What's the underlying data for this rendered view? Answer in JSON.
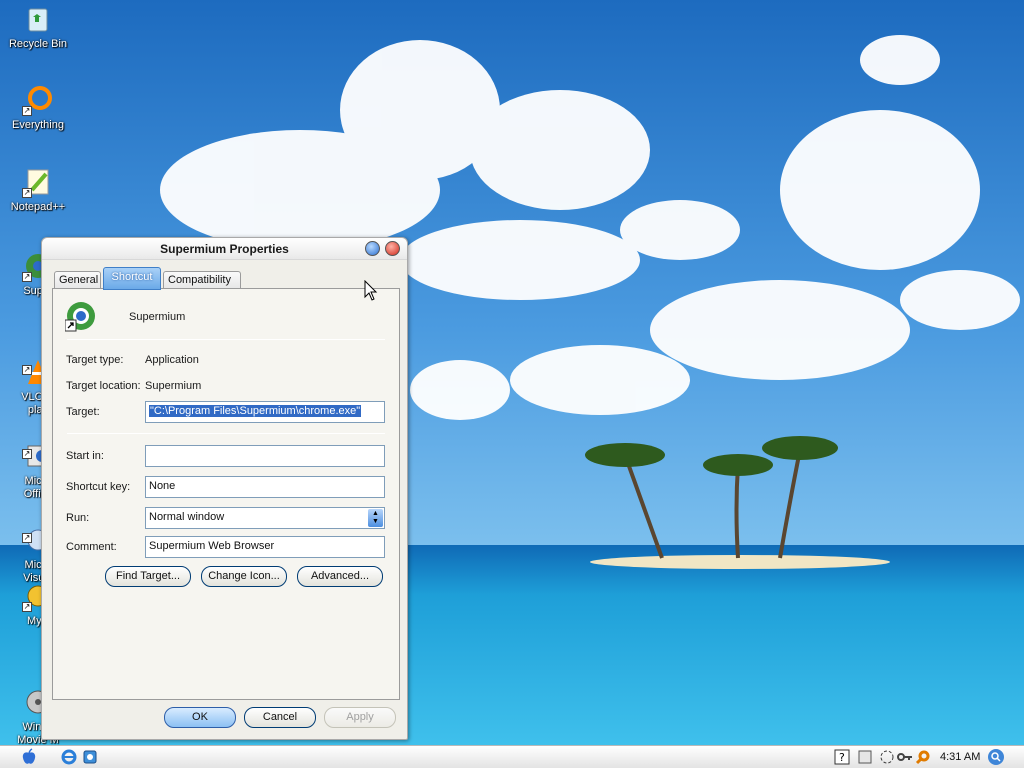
{
  "desktop": {
    "icons": [
      {
        "label": "Recycle Bin"
      },
      {
        "label": "Everything"
      },
      {
        "label": "Notepad++"
      },
      {
        "label": "Super"
      },
      {
        "label": "VLC m\nplay"
      },
      {
        "label": "Micro\nOffice"
      },
      {
        "label": "Micro\nVisual"
      },
      {
        "label": "MyP"
      },
      {
        "label": "Windo\nMovie M"
      }
    ]
  },
  "dialog": {
    "title": "Supermium Properties",
    "tabs": [
      "General",
      "Shortcut",
      "Compatibility"
    ],
    "app_name": "Supermium",
    "target_type_label": "Target type:",
    "target_type": "Application",
    "target_location_label": "Target location:",
    "target_location": "Supermium",
    "target_label": "Target:",
    "target": "\"C:\\Program Files\\Supermium\\chrome.exe\"",
    "start_in_label": "Start in:",
    "start_in": "",
    "shortcut_key_label": "Shortcut key:",
    "shortcut_key": "None",
    "run_label": "Run:",
    "run": "Normal window",
    "comment_label": "Comment:",
    "comment": "Supermium Web Browser",
    "find_target_label": "Find Target...",
    "change_icon_label": "Change Icon...",
    "advanced_label": "Advanced...",
    "ok_label": "OK",
    "cancel_label": "Cancel",
    "apply_label": "Apply"
  },
  "taskbar": {
    "clock": "4:31 AM"
  }
}
